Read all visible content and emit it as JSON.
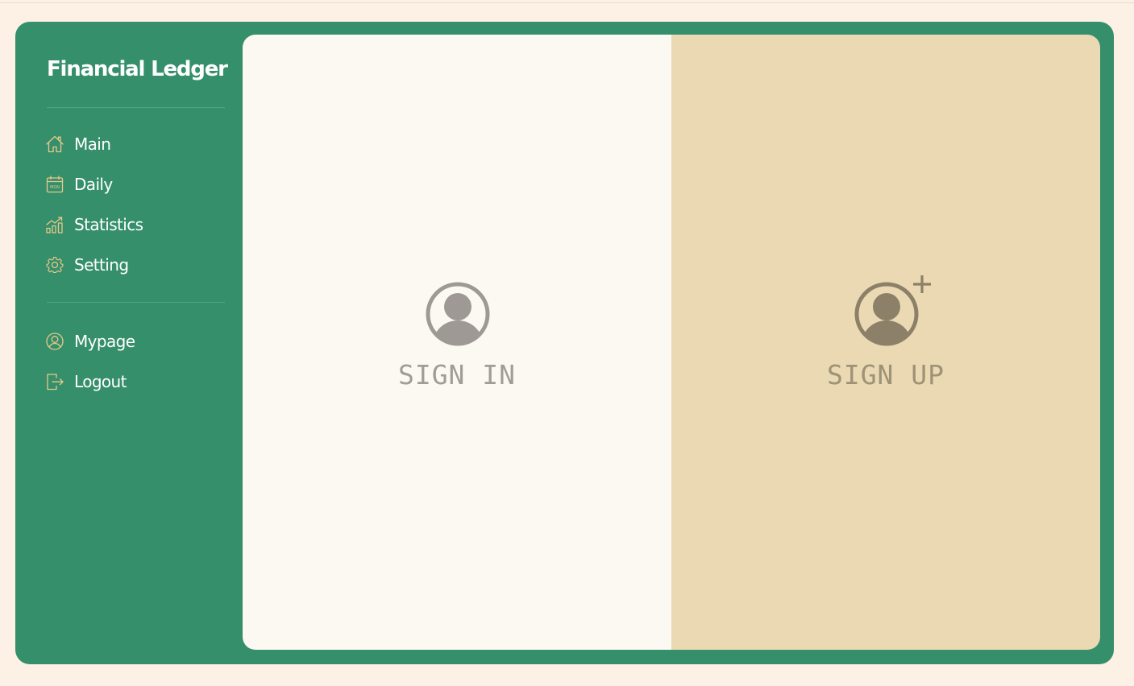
{
  "app": {
    "title": "Financial Ledger"
  },
  "sidebar": {
    "primary": [
      {
        "label": "Main",
        "icon": "home-icon"
      },
      {
        "label": "Daily",
        "icon": "calendar-icon",
        "icon_text": "MON"
      },
      {
        "label": "Statistics",
        "icon": "chart-icon"
      },
      {
        "label": "Setting",
        "icon": "gear-icon"
      }
    ],
    "secondary": [
      {
        "label": "Mypage",
        "icon": "user-circle-icon"
      },
      {
        "label": "Logout",
        "icon": "logout-icon"
      }
    ]
  },
  "auth": {
    "sign_in": {
      "label": "SIGN IN",
      "icon": "user-icon"
    },
    "sign_up": {
      "label": "SIGN UP",
      "icon": "user-plus-icon"
    }
  },
  "colors": {
    "page_background": "#fcf1e4",
    "sidebar_green": "#358f6b",
    "icon_gold": "#e8c98a",
    "sign_in_panel": "#fcf9f2",
    "sign_up_panel": "#ead9b2",
    "sign_in_icon": "#9f9995",
    "sign_up_icon": "#8c8069"
  }
}
